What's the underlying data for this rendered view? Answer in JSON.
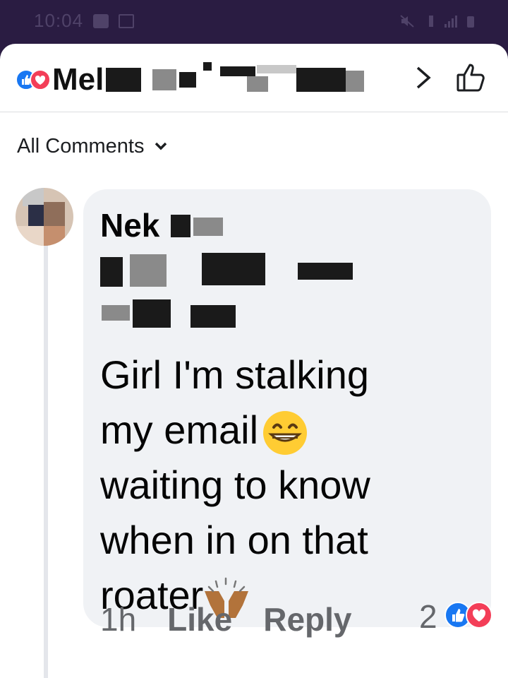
{
  "status_bar": {
    "time": "10:04",
    "icons": [
      "shopping-bag-icon",
      "image-icon",
      "mute-icon",
      "network-icon",
      "signal-icon",
      "battery-icon"
    ]
  },
  "header": {
    "title": "Mel",
    "icons": [
      "like-reaction-icon",
      "love-reaction-icon",
      "chevron-right-icon",
      "thumbs-up-icon"
    ]
  },
  "filter": {
    "label": "All Comments",
    "icon": "chevron-down-icon"
  },
  "comment": {
    "author": "Nek",
    "text_lines": [
      "Girl I'm stalking",
      "my email",
      "waiting to know",
      "when in on that",
      "roater"
    ],
    "emojis": [
      "grinning-face-emoji",
      "raising-hands-emoji"
    ],
    "time": "1h",
    "like_label": "Like",
    "reply_label": "Reply",
    "reaction_count": "2"
  },
  "colors": {
    "status_bg": "#2a1c42",
    "bubble_bg": "#f0f2f5",
    "like_blue": "#1877f2",
    "love_red": "#f33e58",
    "meta_gray": "#65676b"
  }
}
